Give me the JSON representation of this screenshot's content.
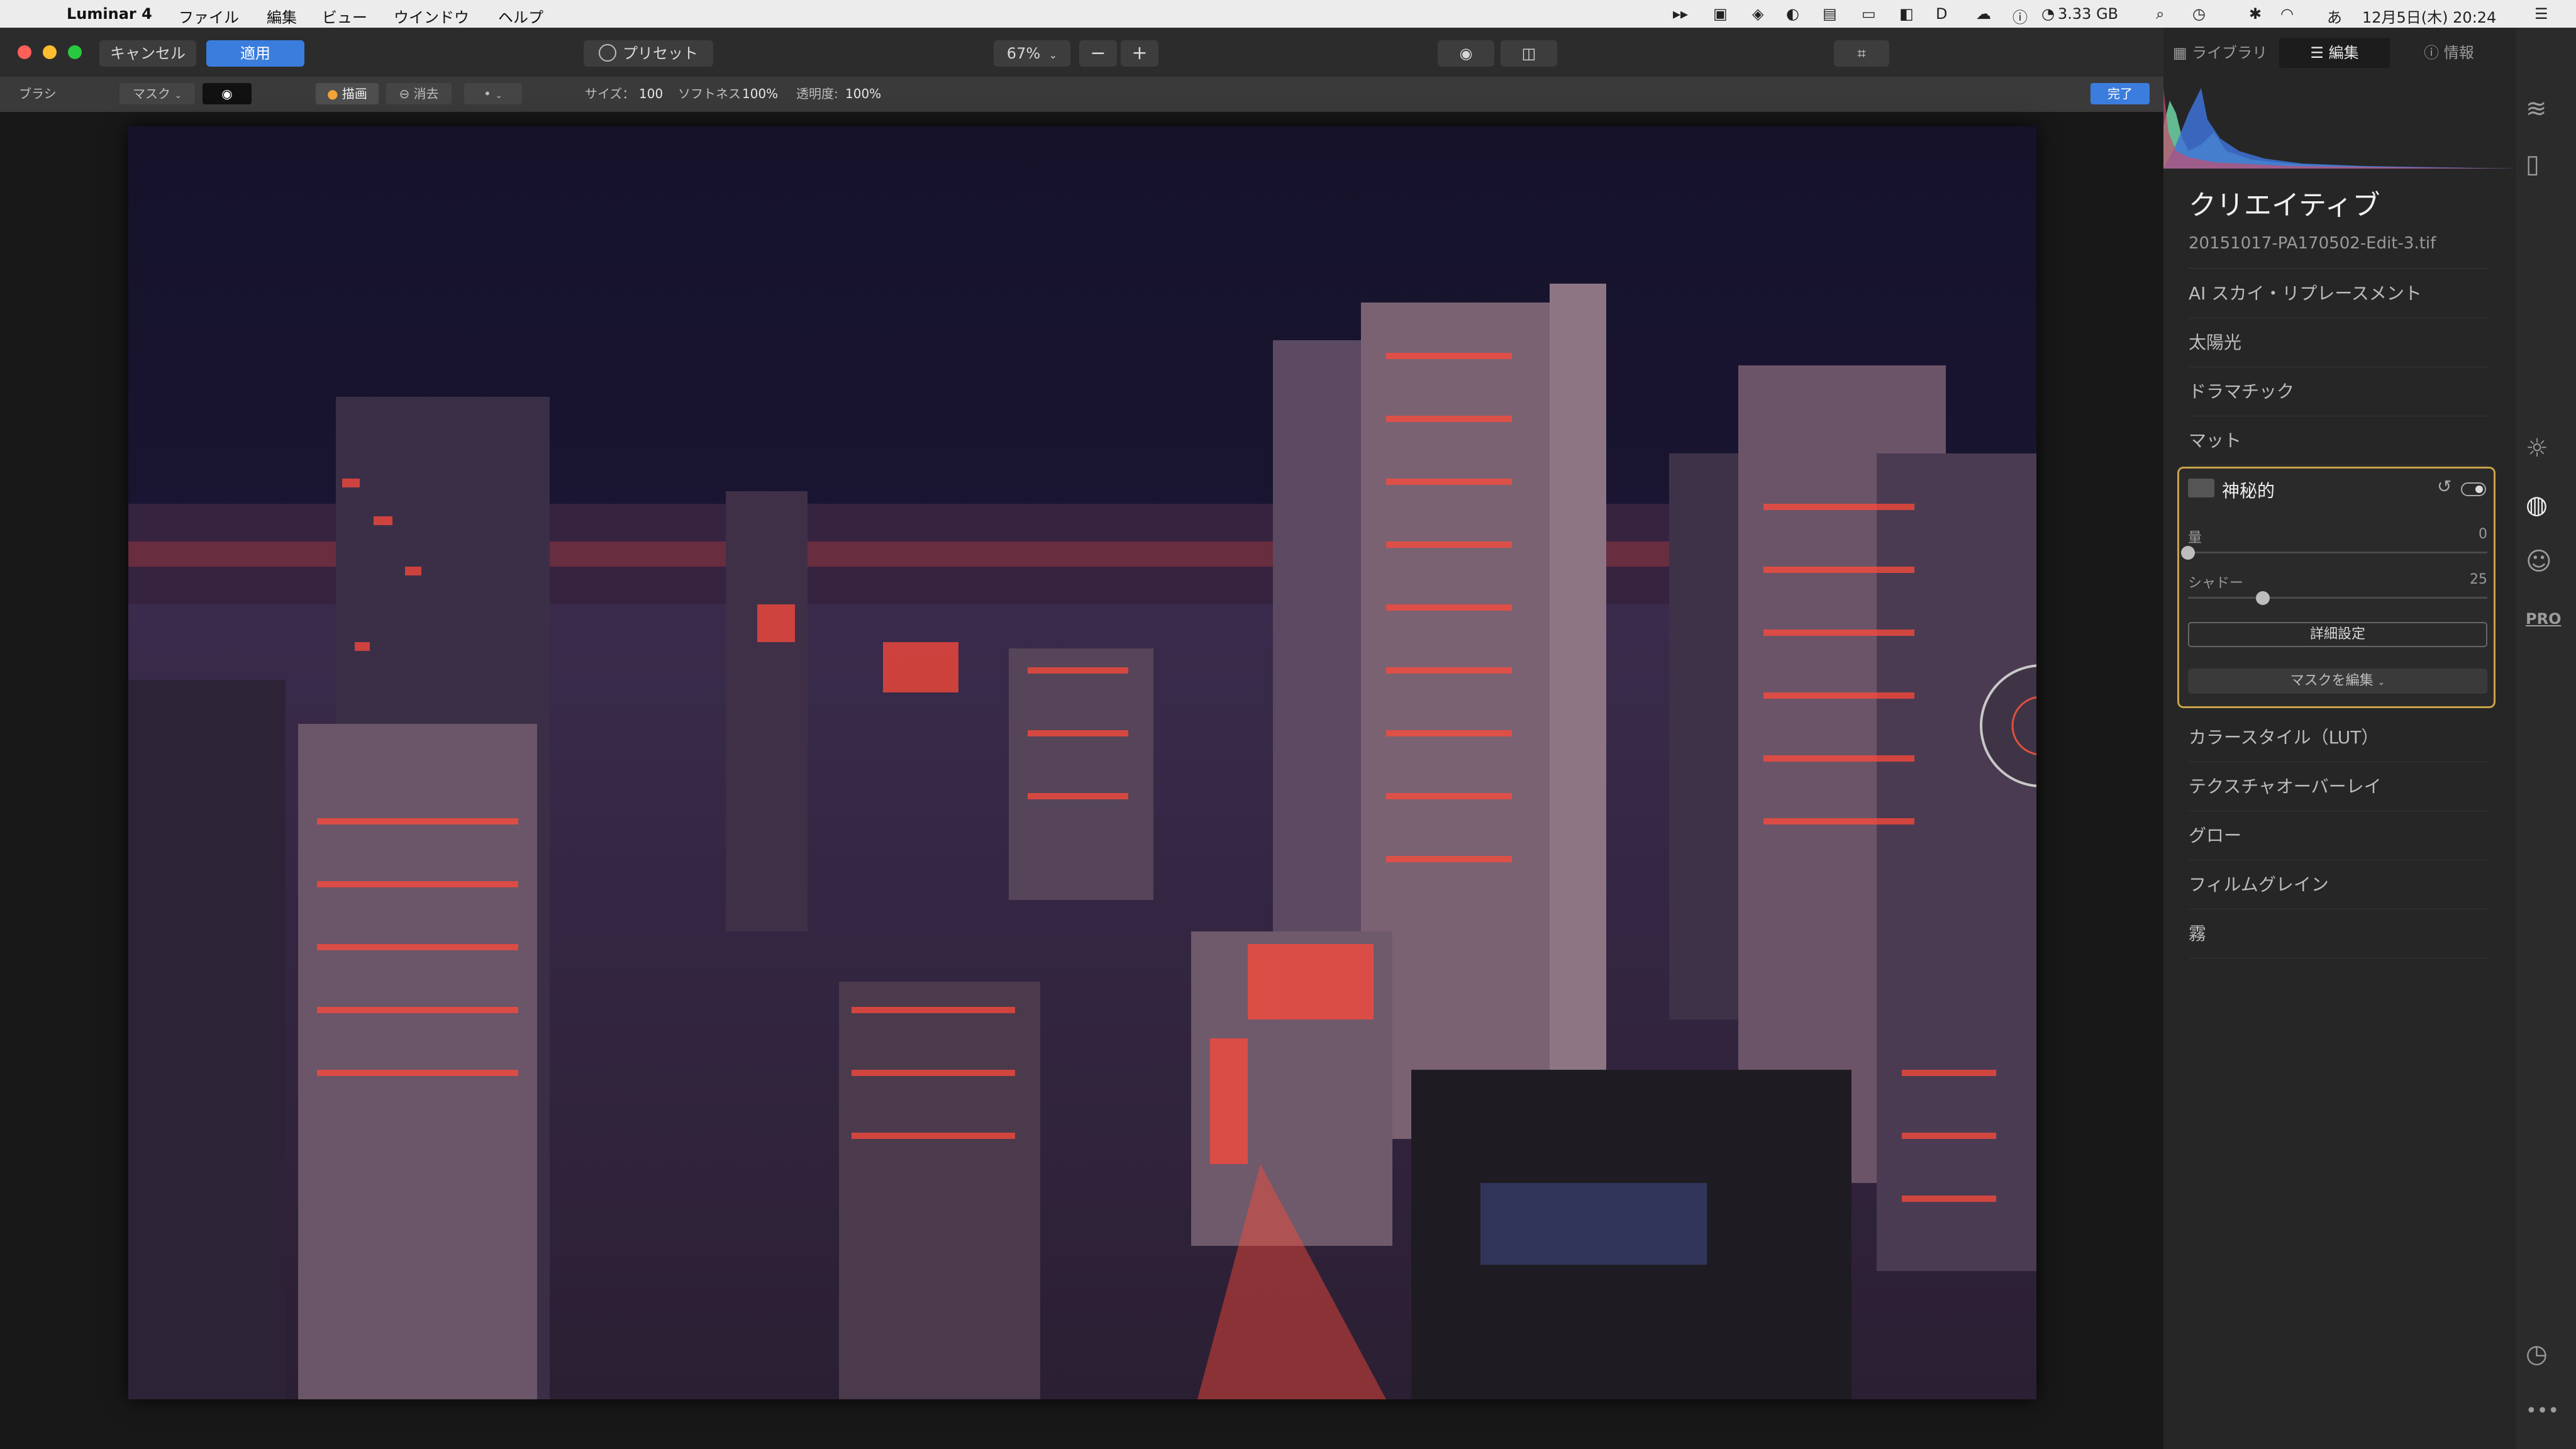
{
  "menubar": {
    "app_name": "Luminar 4",
    "items": [
      "ファイル",
      "編集",
      "ビュー",
      "ウインドウ",
      "ヘルプ"
    ],
    "memory": "3.33 GB",
    "datetime": "12月5日(木)  20:24"
  },
  "toolbar": {
    "cancel_label": "キャンセル",
    "apply_label": "適用",
    "presets_label": "プリセット",
    "zoom_value": "67%",
    "zoom_minus": "−",
    "zoom_plus": "+",
    "tabs": {
      "library": "ライブラリ",
      "edit": "編集",
      "info": "情報"
    }
  },
  "brushbar": {
    "tool_label": "ブラシ",
    "mask_label": "マスク",
    "paint_label": "描画",
    "erase_label": "消去",
    "size_label": "サイズ：",
    "size_value": "100",
    "softness_label": "ソフトネス",
    "softness_value": "100%",
    "opacity_label": "透明度:",
    "opacity_value": "100%",
    "done_label": "完了"
  },
  "panel": {
    "title": "クリエイティブ",
    "filename": "20151017-PA170502-Edit-3.tif",
    "filters_top": [
      "AI スカイ・リプレースメント",
      "太陽光",
      "ドラマチック",
      "マット"
    ],
    "active_filter": {
      "name": "神秘的",
      "sliders": [
        {
          "label": "量",
          "value": "0",
          "fraction": 0.0
        },
        {
          "label": "シャドー",
          "value": "25",
          "fraction": 0.25
        }
      ],
      "advanced_label": "詳細設定",
      "mask_label": "マスクを編集"
    },
    "filters_bottom": [
      "カラースタイル（LUT）",
      "テクスチャオーバーレイ",
      "グロー",
      "フィルムグレイン",
      "霧"
    ]
  },
  "sidebar": {
    "pro_label": "PRO"
  },
  "colors": {
    "accent_blue": "#3b7ddd",
    "active_border": "#c9a24a",
    "mask_overlay": "#ff4a3a"
  }
}
